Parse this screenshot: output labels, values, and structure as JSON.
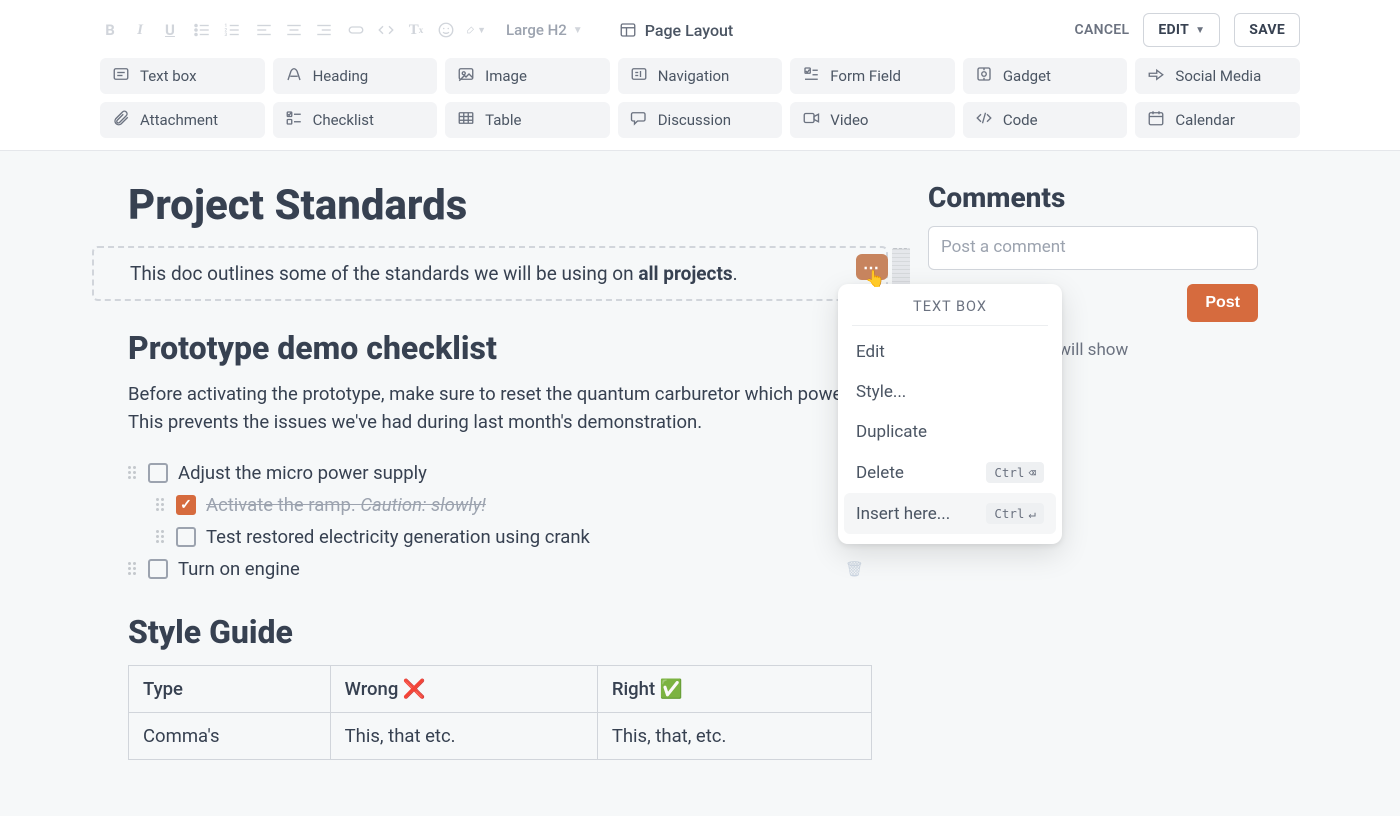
{
  "toolbar": {
    "heading_selector": "Large H2",
    "page_layout_label": "Page Layout",
    "cancel_label": "CANCEL",
    "edit_label": "EDIT",
    "save_label": "SAVE"
  },
  "insert_buttons": [
    {
      "label": "Text box",
      "icon": "textbox-icon"
    },
    {
      "label": "Heading",
      "icon": "heading-icon"
    },
    {
      "label": "Image",
      "icon": "image-icon"
    },
    {
      "label": "Navigation",
      "icon": "navigation-icon"
    },
    {
      "label": "Form Field",
      "icon": "form-icon"
    },
    {
      "label": "Gadget",
      "icon": "gadget-icon"
    },
    {
      "label": "Social Media",
      "icon": "social-icon"
    },
    {
      "label": "Attachment",
      "icon": "attachment-icon"
    },
    {
      "label": "Checklist",
      "icon": "checklist-icon"
    },
    {
      "label": "Table",
      "icon": "table-icon"
    },
    {
      "label": "Discussion",
      "icon": "discussion-icon"
    },
    {
      "label": "Video",
      "icon": "video-icon"
    },
    {
      "label": "Code",
      "icon": "code-icon"
    },
    {
      "label": "Calendar",
      "icon": "calendar-icon"
    }
  ],
  "doc": {
    "title": "Project Standards",
    "intro_prefix": "This doc outlines some of the standards we will be using on ",
    "intro_bold": "all projects",
    "intro_suffix": ".",
    "section1_title": "Prototype demo checklist",
    "section1_body": "Before activating the prototype, make sure to reset the quantum carburetor which powe\nThis prevents the issues we've had during last month's demonstration.",
    "checklist": [
      {
        "label": "Adjust the micro power supply",
        "checked": false,
        "sub": false
      },
      {
        "label": "Activate the ramp. ",
        "label_em": "Caution: slowly!",
        "checked": true,
        "sub": true
      },
      {
        "label": "Test restored electricity generation using crank",
        "checked": false,
        "sub": true
      },
      {
        "label": "Turn on engine",
        "checked": false,
        "sub": false
      }
    ],
    "section2_title": "Style Guide",
    "table": {
      "headers": [
        "Type",
        "Wrong ❌",
        "Right ✅"
      ],
      "rows": [
        [
          "Comma's",
          "This, that etc.",
          "This, that, etc."
        ]
      ]
    }
  },
  "context_menu": {
    "title": "TEXT BOX",
    "items": [
      {
        "label": "Edit"
      },
      {
        "label": "Style..."
      },
      {
        "label": "Duplicate"
      },
      {
        "label": "Delete",
        "shortcut_key": "Ctrl",
        "shortcut_glyph": "⌫"
      },
      {
        "label": "Insert here...",
        "shortcut_key": "Ctrl",
        "shortcut_glyph": "↵",
        "selected": true
      }
    ]
  },
  "comments": {
    "title": "Comments",
    "placeholder": "Post a comment",
    "post_label": "Post",
    "hint_suffix": " page, comments will show"
  },
  "colors": {
    "accent": "#d66b3e"
  }
}
